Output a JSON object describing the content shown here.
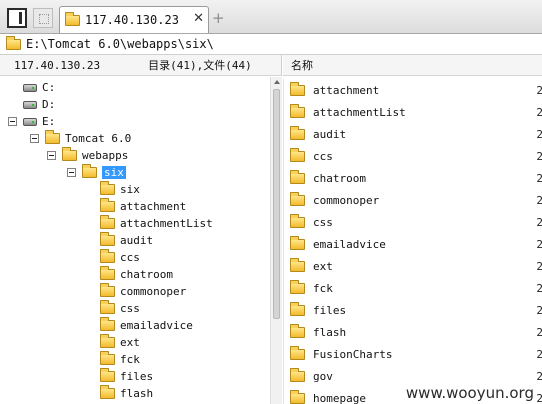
{
  "tabbar": {
    "tab_title": "117.40.130.23",
    "close_glyph": "✕",
    "add_glyph": "+"
  },
  "pathbar": {
    "path": "E:\\Tomcat 6.0\\webapps\\six\\"
  },
  "left_header": {
    "host": "117.40.130.23",
    "counts": "目录(41),文件(44)"
  },
  "right_header": {
    "name_column": "名称"
  },
  "tree": [
    {
      "label": "C:",
      "kind": "drive",
      "level": 0
    },
    {
      "label": "D:",
      "kind": "drive",
      "level": 0
    },
    {
      "label": "E:",
      "kind": "drive",
      "level": 0,
      "expanded": true
    },
    {
      "label": "Tomcat 6.0",
      "kind": "folder",
      "level": 1,
      "expanded": true
    },
    {
      "label": "webapps",
      "kind": "folder",
      "level": 2,
      "expanded": true
    },
    {
      "label": "six",
      "kind": "folder",
      "level": 3,
      "expanded": true,
      "selected": true
    },
    {
      "label": "six",
      "kind": "folder",
      "level": 4
    },
    {
      "label": "attachment",
      "kind": "folder",
      "level": 4
    },
    {
      "label": "attachmentList",
      "kind": "folder",
      "level": 4
    },
    {
      "label": "audit",
      "kind": "folder",
      "level": 4
    },
    {
      "label": "ccs",
      "kind": "folder",
      "level": 4
    },
    {
      "label": "chatroom",
      "kind": "folder",
      "level": 4
    },
    {
      "label": "commonoper",
      "kind": "folder",
      "level": 4
    },
    {
      "label": "css",
      "kind": "folder",
      "level": 4
    },
    {
      "label": "emailadvice",
      "kind": "folder",
      "level": 4
    },
    {
      "label": "ext",
      "kind": "folder",
      "level": 4
    },
    {
      "label": "fck",
      "kind": "folder",
      "level": 4
    },
    {
      "label": "files",
      "kind": "folder",
      "level": 4
    },
    {
      "label": "flash",
      "kind": "folder",
      "level": 4
    }
  ],
  "list": [
    {
      "name": "attachment",
      "extra": "2"
    },
    {
      "name": "attachmentList",
      "extra": "2"
    },
    {
      "name": "audit",
      "extra": "2"
    },
    {
      "name": "ccs",
      "extra": "2"
    },
    {
      "name": "chatroom",
      "extra": "2"
    },
    {
      "name": "commonoper",
      "extra": "2"
    },
    {
      "name": "css",
      "extra": "2"
    },
    {
      "name": "emailadvice",
      "extra": "2"
    },
    {
      "name": "ext",
      "extra": "2"
    },
    {
      "name": "fck",
      "extra": "2"
    },
    {
      "name": "files",
      "extra": "2"
    },
    {
      "name": "flash",
      "extra": "2"
    },
    {
      "name": "FusionCharts",
      "extra": "2"
    },
    {
      "name": "gov",
      "extra": "2"
    },
    {
      "name": "homepage",
      "extra": "2"
    }
  ],
  "watermark": "www.wooyun.org",
  "colors": {
    "selection": "#3399ff",
    "folder": "#f3bb2c"
  }
}
